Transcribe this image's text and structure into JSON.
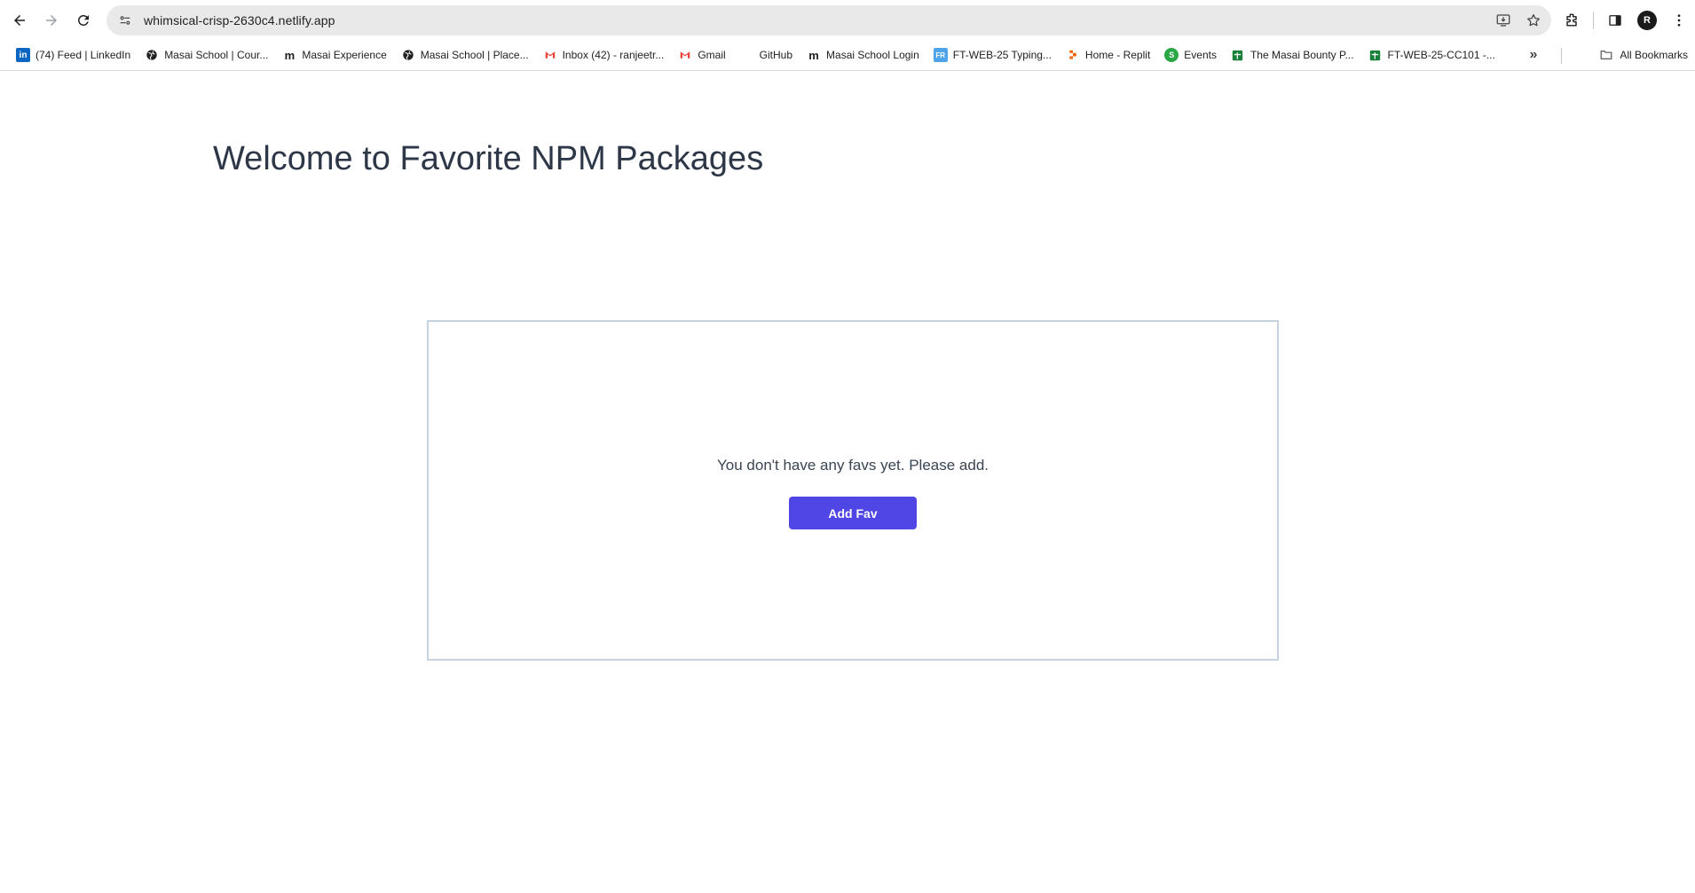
{
  "browser": {
    "url": "whimsical-crisp-2630c4.netlify.app",
    "bookmarks": [
      {
        "label": "(74) Feed | LinkedIn",
        "icon": "linkedin-icon",
        "color": "#0a66c2"
      },
      {
        "label": "Masai School | Cour...",
        "icon": "globe-icon",
        "color": "#202124"
      },
      {
        "label": "Masai Experience",
        "icon": "masai-m-icon",
        "color": "#202124"
      },
      {
        "label": "Masai School | Place...",
        "icon": "globe-icon",
        "color": "#202124"
      },
      {
        "label": "Inbox (42) - ranjeetr...",
        "icon": "gmail-icon",
        "color": "#ea4335"
      },
      {
        "label": "Gmail",
        "icon": "gmail-icon",
        "color": "#ea4335"
      },
      {
        "label": "GitHub",
        "icon": "github-icon",
        "color": "#ffffff"
      },
      {
        "label": "Masai School Login",
        "icon": "masai-m-icon",
        "color": "#202124"
      },
      {
        "label": "FT-WEB-25 Typing...",
        "icon": "typing-icon",
        "color": "#4fa3e8"
      },
      {
        "label": "Home - Replit",
        "icon": "replit-icon",
        "color": "#f26207"
      },
      {
        "label": "Events",
        "icon": "events-icon",
        "color": "#2aa745"
      },
      {
        "label": "The Masai Bounty P...",
        "icon": "sheets-icon",
        "color": "#188038"
      },
      {
        "label": "FT-WEB-25-CC101 -...",
        "icon": "sheets-icon",
        "color": "#188038"
      }
    ],
    "all_bookmarks_label": "All Bookmarks"
  },
  "page": {
    "title": "Welcome to Favorite NPM Packages",
    "empty_message": "You don't have any favs yet. Please add.",
    "add_button_label": "Add Fav"
  },
  "colors": {
    "accent": "#4f46e5",
    "title": "#2d3748",
    "panel_border": "#c5d3e0"
  }
}
